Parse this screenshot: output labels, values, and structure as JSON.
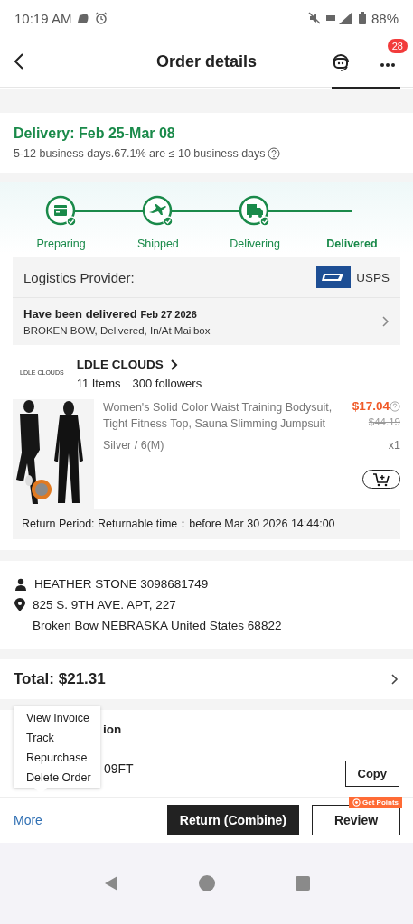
{
  "status_bar": {
    "time": "10:19 AM",
    "battery": "88%"
  },
  "header": {
    "title": "Order details",
    "badge": "28"
  },
  "delivery": {
    "title": "Delivery: Feb 25-Mar 08",
    "note": "5-12 business days.67.1% are ≤ 10 business days"
  },
  "steps": [
    {
      "label": "Preparing",
      "kind": "box",
      "selected": false
    },
    {
      "label": "Shipped",
      "kind": "plane",
      "selected": false
    },
    {
      "label": "Delivering",
      "kind": "truck",
      "selected": false
    },
    {
      "label": "Delivered",
      "kind": "blank",
      "selected": true
    }
  ],
  "logistics": {
    "label": "Logistics Provider:",
    "carrier": "USPS",
    "status": "Have been delivered",
    "date": "Feb 27 2026",
    "detail": "BROKEN BOW, Delivered, In/At Mailbox"
  },
  "store": {
    "logo_text": "LDLE CLOUDS",
    "name": "LDLE CLOUDS",
    "items": "11 Items",
    "followers": "300 followers"
  },
  "product": {
    "kind": "picture",
    "title": "Women's Solid Color Waist Training Bodysuit, Tight Fitness Top, Sauna Slimming Jumpsuit",
    "price": "$17.04",
    "old_price": "$44.19",
    "variant": "Silver / 6(M)",
    "quantity": "x1"
  },
  "return_period": "Return Period: Returnable time：before Mar 30 2026 14:44:00",
  "address": {
    "name": "HEATHER STONE 3098681749",
    "line1": "825 S. 9TH AVE. APT, 227",
    "line2": "Broken Bow NEBRASKA United States 68822"
  },
  "total": "Total: $21.31",
  "order_info": {
    "title_fragment": "ion",
    "value_fragment": "09FT",
    "copy": "Copy"
  },
  "menu": [
    "View Invoice",
    "Track",
    "Repurchase",
    "Delete Order"
  ],
  "actions": {
    "more": "More",
    "return": "Return (Combine)",
    "review": "Review",
    "points_badge": "Get Points"
  }
}
